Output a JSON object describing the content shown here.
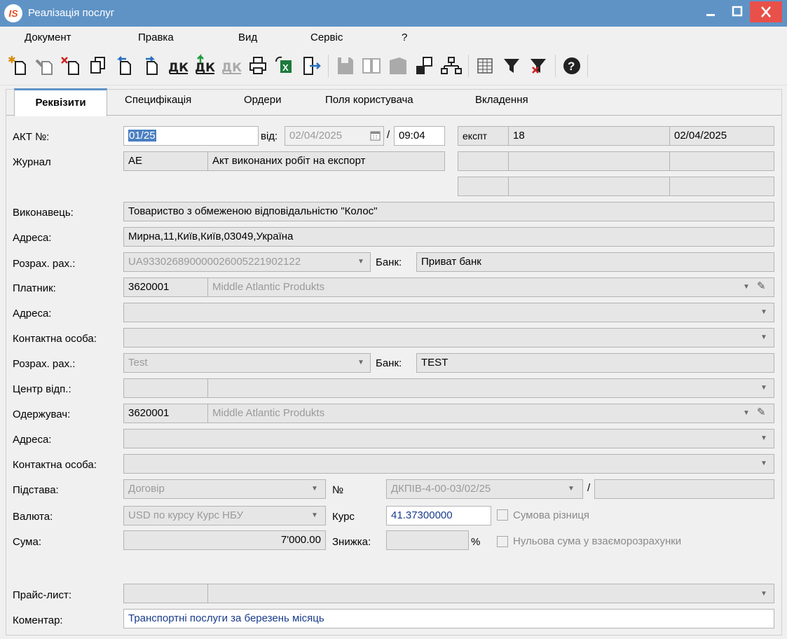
{
  "window": {
    "title": "Реалізація послуг",
    "logo": "IS"
  },
  "menu": [
    "Документ",
    "Правка",
    "Вид",
    "Сервіс",
    "?"
  ],
  "toolbar_icons": [
    "new-doc-icon",
    "edit-doc-icon",
    "delete-doc-icon",
    "copy-doc-icon",
    "doc-back-icon",
    "doc-forward-icon",
    "dk-icon",
    "dk-green-icon",
    "dk-gray-icon",
    "print-icon",
    "excel-export-icon",
    "exit-icon",
    "save-icon",
    "book-icon",
    "folder-icon",
    "tree-link-icon",
    "hierarchy-icon",
    "grid-icon",
    "filter-icon",
    "clear-filter-icon",
    "help-icon"
  ],
  "tabs": [
    "Реквізити",
    "Специфікація",
    "Ордери",
    "Поля користувача",
    "Вкладення"
  ],
  "labels": {
    "act": "АКТ №:",
    "journal": "Журнал",
    "executor": "Виконавець:",
    "address": "Адреса:",
    "account": "Розрах. рах.:",
    "payer": "Платник:",
    "contact": "Контактна особа:",
    "center": "Центр відп.:",
    "receiver": "Одержувач:",
    "basis": "Підстава:",
    "currency": "Валюта:",
    "sum": "Сума:",
    "pricelist": "Прайс-лист:",
    "comment": "Коментар:",
    "from": "від:",
    "slash": "/",
    "bank": "Банк:",
    "num": "№",
    "rate": "Курс",
    "discount": "Знижка:",
    "percent": "%"
  },
  "values": {
    "act_number": "01/25",
    "date": "02/04/2025",
    "time": "09:04",
    "export_code": "експт",
    "export_num": "18",
    "export_date": "02/04/2025",
    "journal_code": "АЕ",
    "journal_name": "Акт виконаних робіт на експорт",
    "executor": "Товариство з обмеженою відповідальністю \"Колос\"",
    "executor_address": "Мирна,11,Київ,Київ,03049,Україна",
    "executor_account": "UA933026890000026005221902122",
    "executor_bank": "Приват банк",
    "payer_code": "3620001",
    "payer_name": "Middle Atlantic Produkts",
    "payer_account": "Test",
    "payer_bank": "TEST",
    "receiver_code": "3620001",
    "receiver_name": "Middle Atlantic Produkts",
    "basis": "Договір",
    "basis_number": "ДКПІВ-4-00-03/02/25",
    "currency": "USD по курсу Курс НБУ",
    "rate": "41.37300000",
    "sum": "7'000.00",
    "comment": "Транспортні послуги за березень місяць"
  },
  "checkboxes": {
    "sum_diff": {
      "label": "Сумова різниця",
      "checked": false
    },
    "zero_sum": {
      "label": "Нульова сума у взаєморозрахунки",
      "checked": false
    }
  }
}
